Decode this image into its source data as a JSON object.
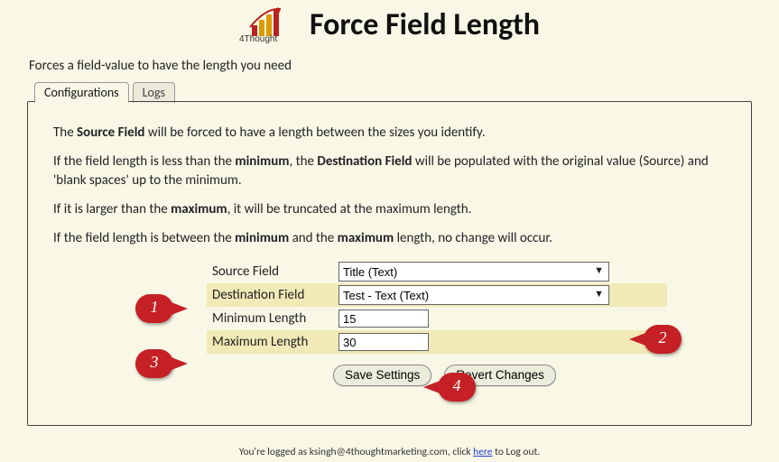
{
  "header": {
    "title": "Force Field Length",
    "subtitle": "Forces a field-value to have the length you need"
  },
  "tabs": [
    {
      "label": "Configurations",
      "active": true
    },
    {
      "label": "Logs",
      "active": false
    }
  ],
  "description": {
    "p1_pre": "The ",
    "p1_b1": "Source Field",
    "p1_post": " will be forced to have a length between the sizes you identify.",
    "p2_pre": "If the field length is less than the ",
    "p2_b1": "minimum",
    "p2_mid1": ", the ",
    "p2_b2": "Destination Field",
    "p2_post": " will be populated with the original value (Source) and 'blank spaces' up to the minimum.",
    "p3_pre": "If it is larger than the ",
    "p3_b1": "maximum",
    "p3_post": ", it will be truncated at the maximum length.",
    "p4_pre": "If the field length is between the ",
    "p4_b1": "minimum",
    "p4_mid": " and the ",
    "p4_b2": "maximum",
    "p4_post": " length, no change will occur."
  },
  "form": {
    "source_label": "Source Field",
    "source_value": "Title (Text)",
    "dest_label": "Destination Field",
    "dest_value": "Test - Text (Text)",
    "min_label": "Minimum Length",
    "min_value": "15",
    "max_label": "Maximum Length",
    "max_value": "30"
  },
  "buttons": {
    "save": "Save Settings",
    "revert": "Revert Changes"
  },
  "footer": {
    "pre": "You're logged as ksingh@4thoughtmarketing.com, click ",
    "link": "here",
    "post": " to Log out."
  },
  "callouts": {
    "c1": "1",
    "c2": "2",
    "c3": "3",
    "c4": "4"
  }
}
